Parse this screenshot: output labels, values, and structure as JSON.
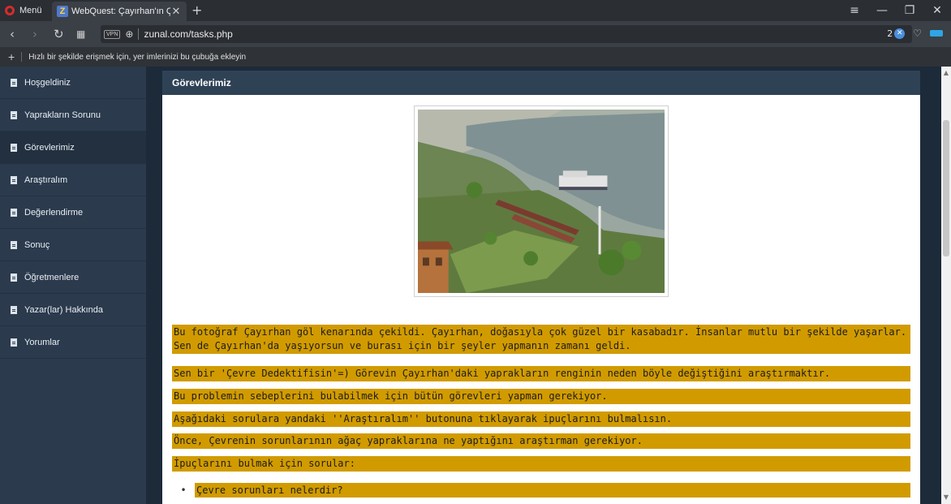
{
  "browser": {
    "menu_label": "Menü",
    "tab_title": "WebQuest: Çayırhan'ın Çe",
    "url": "zunal.com/tasks.php",
    "vpn_label": "VPN",
    "blocked_count": "2",
    "bookmark_hint": "Hızlı bir şekilde erişmek için, yer imlerinizi bu çubuğa ekleyin"
  },
  "sidebar": {
    "items": [
      {
        "label": "Hoşgeldiniz"
      },
      {
        "label": "Yaprakların Sorunu"
      },
      {
        "label": "Görevlerimiz"
      },
      {
        "label": "Araştıralım"
      },
      {
        "label": "Değerlendirme"
      },
      {
        "label": "Sonuç"
      },
      {
        "label": "Öğretmenlere"
      },
      {
        "label": "Yazar(lar) Hakkında"
      },
      {
        "label": "Yorumlar"
      }
    ]
  },
  "content": {
    "title": "Görevlerimiz",
    "paragraphs": [
      " Bu fotoğraf Çayırhan göl kenarında çekildi. Çayırhan, doğasıyla çok güzel bir kasabadır. İnsanlar mutlu bir şekilde yaşarlar. Sen de Çayırhan'da yaşıyorsun ve burası için bir şeyler yapmanın zamanı geldi.",
      " Sen bir 'Çevre Dedektifisin'=)  Görevin Çayırhan'daki yaprakların renginin neden böyle değiştiğini araştırmaktır.",
      "Bu problemin sebeplerini bulabilmek için bütün görevleri yapman gerekiyor.",
      "Aşağıdaki sorulara yandaki ''Araştıralım'' butonuna tıklayarak ipuçlarını bulmalısın.",
      "Önce, Çevrenin sorunlarının ağaç yapraklarına ne yaptığını araştırman gerekiyor.",
      "İpuçlarını bulmak için sorular:"
    ],
    "bullets": [
      "Çevre sorunları nelerdir?"
    ]
  },
  "colors": {
    "highlight": "#d19b00",
    "header_bg": "#2f4255",
    "sidebar_bg": "#2b3a4c"
  }
}
